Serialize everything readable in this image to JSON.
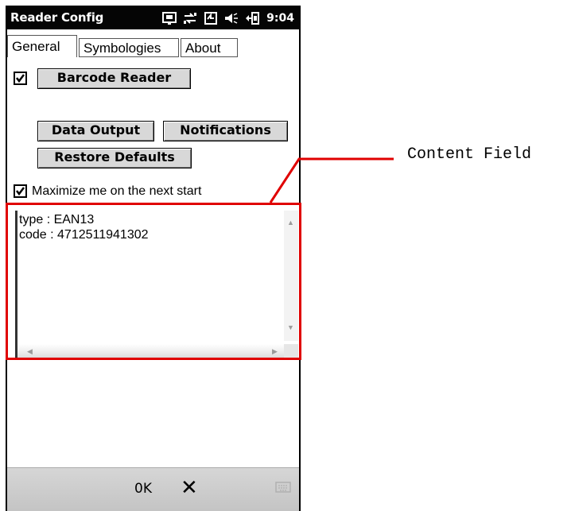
{
  "titlebar": {
    "title": "Reader Config",
    "time": "9:04"
  },
  "tabs": [
    {
      "label": "General",
      "active": true
    },
    {
      "label": "Symbologies",
      "active": false
    },
    {
      "label": "About",
      "active": false
    }
  ],
  "general": {
    "barcode_reader": {
      "label": "Barcode Reader",
      "checked": true
    },
    "data_output_label": "Data Output",
    "notifications_label": "Notifications",
    "restore_defaults_label": "Restore Defaults",
    "maximize": {
      "label": "Maximize me on the next start",
      "checked": true
    }
  },
  "content_field": {
    "line1": "type : EAN13",
    "line2": "code : 4712511941302"
  },
  "softkeys": {
    "ok_label": "0K",
    "cancel_label": "✕"
  },
  "annotation": {
    "label": "Content Field",
    "color": "#e00000"
  },
  "icons": [
    "phone-signal-icon",
    "network-sync-icon",
    "battery-charging-icon",
    "speaker-icon",
    "connectivity-icon",
    "keyboard-icon",
    "check-icon"
  ]
}
